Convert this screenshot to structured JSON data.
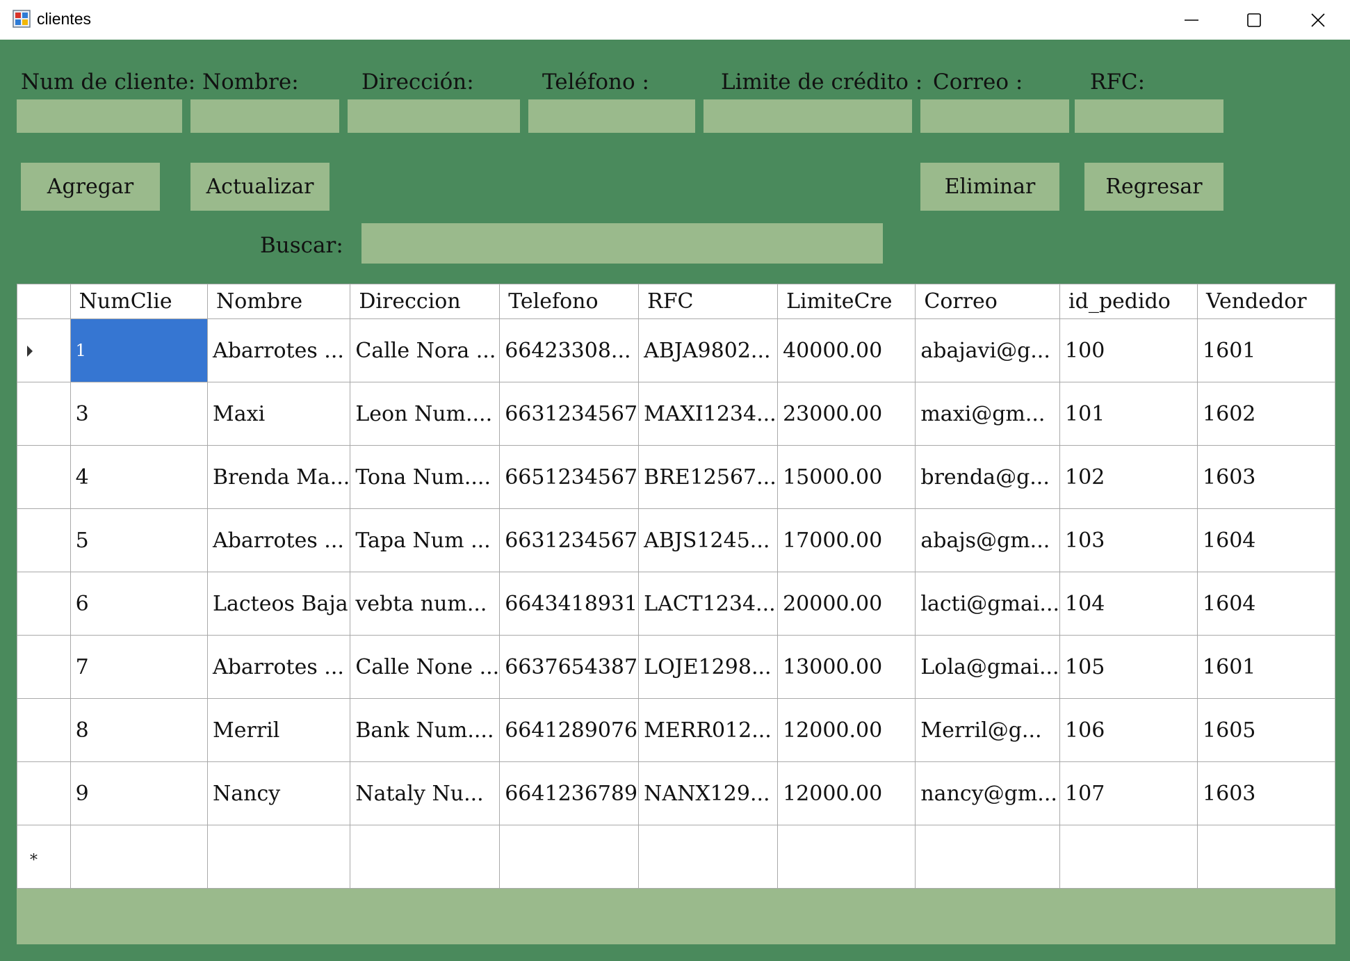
{
  "window": {
    "title": "clientes",
    "icon": "winforms-app-icon",
    "controls": [
      "minimize-icon",
      "maximize-icon",
      "close-icon"
    ]
  },
  "form": {
    "labels": {
      "num_cliente": "Num de cliente:",
      "nombre": "Nombre:",
      "direccion": "Dirección:",
      "telefono": "Teléfono :",
      "limite": "Limite de crédito :",
      "correo": "Correo :",
      "rfc": "RFC:",
      "buscar": "Buscar:"
    },
    "values": {
      "num_cliente": "",
      "nombre": "",
      "direccion": "",
      "telefono": "",
      "limite": "",
      "correo": "",
      "rfc": "",
      "buscar": ""
    }
  },
  "buttons": {
    "agregar": "Agregar",
    "actualizar": "Actualizar",
    "eliminar": "Eliminar",
    "regresar": "Regresar"
  },
  "grid": {
    "columns": [
      "NumClie",
      "Nombre",
      "Direccion",
      "Telefono",
      "RFC",
      "LimiteCre",
      "Correo",
      "id_pedido",
      "Vendedor"
    ],
    "rows": [
      [
        "1",
        "Abarrotes ...",
        "Calle Nora ...",
        "66423308...",
        "ABJA9802...",
        "40000.00",
        "abajavi@g...",
        "100",
        "1601"
      ],
      [
        "3",
        "Maxi",
        "Leon Num....",
        "6631234567",
        "MAXI1234...",
        "23000.00",
        "maxi@gm...",
        "101",
        "1602"
      ],
      [
        "4",
        "Brenda Ma...",
        "Tona Num....",
        "6651234567",
        "BRE12567...",
        "15000.00",
        "brenda@g...",
        "102",
        "1603"
      ],
      [
        "5",
        "Abarrotes ...",
        "Tapa Num ...",
        "6631234567",
        "ABJS1245...",
        "17000.00",
        "abajs@gm...",
        "103",
        "1604"
      ],
      [
        "6",
        "Lacteos Baja",
        "vebta num...",
        "6643418931",
        "LACT1234...",
        "20000.00",
        "lacti@gmai...",
        "104",
        "1604"
      ],
      [
        "7",
        "Abarrotes ...",
        "Calle None ...",
        "6637654387",
        "LOJE1298...",
        "13000.00",
        "Lola@gmai...",
        "105",
        "1601"
      ],
      [
        "8",
        "Merril",
        "Bank Num....",
        "6641289076",
        "MERR012...",
        "12000.00",
        "Merril@g...",
        "106",
        "1605"
      ],
      [
        "9",
        "Nancy",
        "Nataly Nu...",
        "6641236789",
        "NANX129...",
        "12000.00",
        "nancy@gm...",
        "107",
        "1603"
      ]
    ],
    "selected_row": 0,
    "new_row_marker": "*"
  },
  "colors": {
    "form_background": "#4a8a5c",
    "control_background": "#9aba8c",
    "selection": "#3676d2"
  }
}
